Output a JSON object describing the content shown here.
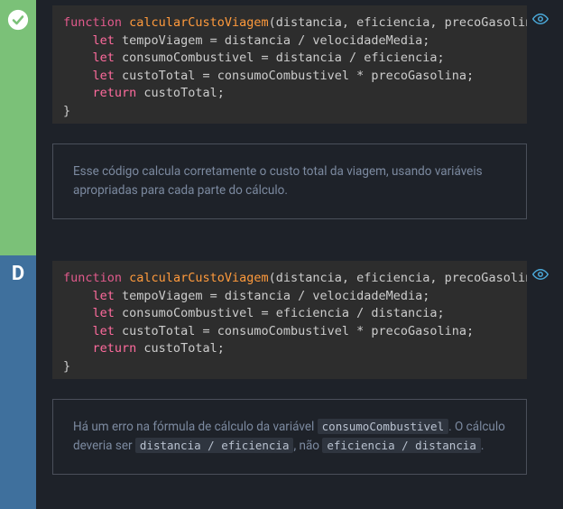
{
  "panels": [
    {
      "gutter": {
        "type": "check",
        "bg": "green"
      },
      "code": {
        "fn_keyword": "function",
        "fn_name": "calcularCustoViagem",
        "params": "(distancia, eficiencia, precoGasolina, velocidadeMedia) {",
        "lines": [
          {
            "let": "let",
            "var": "tempoViagem",
            "rest": " = distancia / velocidadeMedia;"
          },
          {
            "let": "let",
            "var": "consumoCombustivel",
            "rest": " = distancia / eficiencia;"
          },
          {
            "let": "let",
            "var": "custoTotal",
            "rest": " = consumoCombustivel * precoGasolina;"
          }
        ],
        "ret_kw": "return",
        "ret_val": " custoTotal;",
        "close": "}"
      },
      "explain_plain": "Esse código calcula corretamente o custo total da viagem, usando variáveis apropriadas para cada parte do cálculo."
    },
    {
      "gutter": {
        "type": "letter",
        "label": "D",
        "bg": "blue"
      },
      "code": {
        "fn_keyword": "function",
        "fn_name": "calcularCustoViagem",
        "params": "(distancia, eficiencia, precoGasolina, velocidadeMedia) {",
        "lines": [
          {
            "let": "let",
            "var": "tempoViagem",
            "rest": " = distancia / velocidadeMedia;"
          },
          {
            "let": "let",
            "var": "consumoCombustivel",
            "rest": " = eficiencia / distancia;"
          },
          {
            "let": "let",
            "var": "custoTotal",
            "rest": " = consumoCombustivel * precoGasolina;"
          }
        ],
        "ret_kw": "return",
        "ret_val": " custoTotal;",
        "close": "}"
      },
      "explain_parts": {
        "t1": "Há um erro na fórmula de cálculo da variável ",
        "c1": "consumoCombustivel",
        "t2": ". O cálculo deveria ser ",
        "c2": "distancia / eficiencia",
        "t3": ", não ",
        "c3": "eficiencia / distancia",
        "t4": "."
      }
    }
  ]
}
